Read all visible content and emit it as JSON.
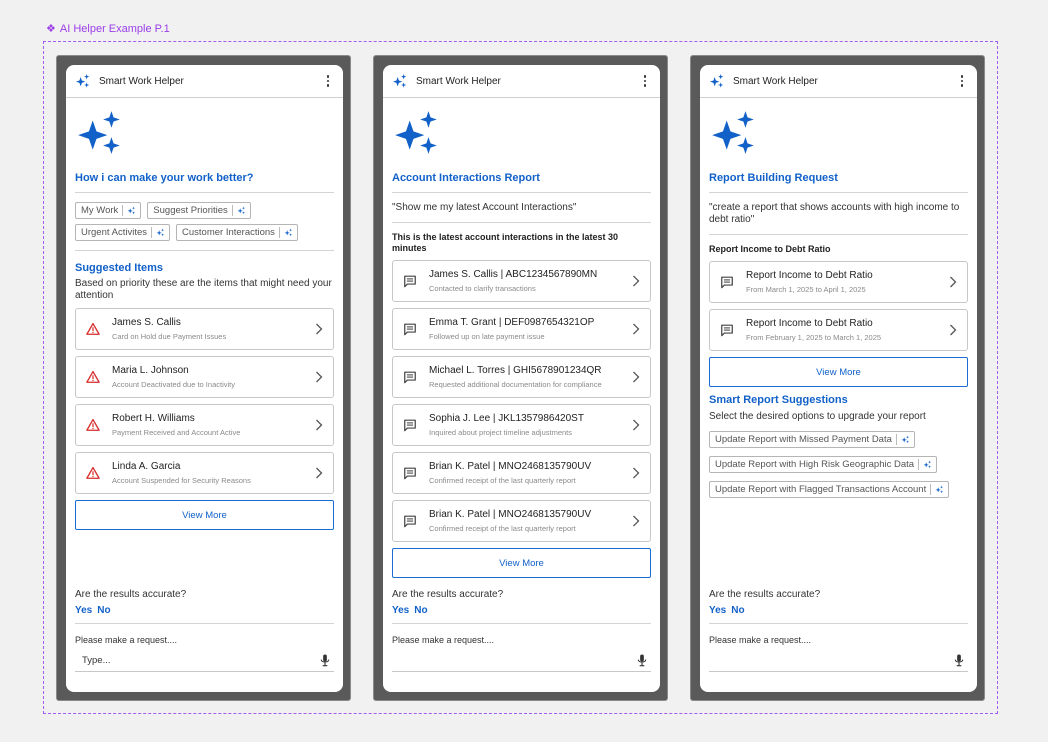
{
  "frame_label": "AI Helper Example P.1",
  "colors": {
    "accent": "#1261c9",
    "frame": "#a35cf0",
    "alert": "#d62b2b",
    "phone_bezel": "#5a5a5a"
  },
  "app_title": "Smart Work Helper",
  "footer": {
    "question": "Are the results accurate?",
    "yes": "Yes",
    "no": "No",
    "request_label": "Please make a request....",
    "input_value": "Type...",
    "input_value_empty": ""
  },
  "view_more": "View More",
  "screen1": {
    "title": "How i can make your work better?",
    "chips": [
      "My Work",
      "Suggest Priorities",
      "Urgent Activites",
      "Customer Interactions"
    ],
    "suggested_title": "Suggested Items",
    "suggested_desc": "Based on priority these are the items that might need your attention",
    "items": [
      {
        "name": "James S. Callis",
        "detail": "Card on Hold due Payment Issues",
        "icon": "warning-icon"
      },
      {
        "name": "Maria L. Johnson",
        "detail": "Account Deactivated due to Inactivity",
        "icon": "warning-icon"
      },
      {
        "name": "Robert H. Williams",
        "detail": "Payment Received and Account Active",
        "icon": "warning-icon"
      },
      {
        "name": "Linda A. Garcia",
        "detail": "Account Suspended for Security Reasons",
        "icon": "warning-icon"
      }
    ]
  },
  "screen2": {
    "title": "Account Interactions Report",
    "query": "\"Show me my latest Account Interactions\"",
    "result_header": "This is the latest account interactions in the latest 30 minutes",
    "items": [
      {
        "name": "James S. Callis | ABC1234567890MN",
        "detail": "Contacted to clarify transactions",
        "icon": "message-icon"
      },
      {
        "name": "Emma T. Grant | DEF0987654321OP",
        "detail": "Followed up on late payment issue",
        "icon": "message-icon"
      },
      {
        "name": "Michael L. Torres | GHI5678901234QR",
        "detail": "Requested additional documentation for compliance",
        "icon": "message-icon"
      },
      {
        "name": "Sophia J. Lee | JKL1357986420ST",
        "detail": "Inquired about project timeline adjustments",
        "icon": "message-icon"
      },
      {
        "name": "Brian K. Patel | MNO2468135790UV",
        "detail": "Confirmed receipt of the last quarterly report",
        "icon": "message-icon"
      },
      {
        "name": "Brian K. Patel | MNO2468135790UV",
        "detail": "Confirmed receipt of the last quarterly report",
        "icon": "message-icon"
      }
    ]
  },
  "screen3": {
    "title": "Report Building Request",
    "query": "\"create a report that shows accounts with high income to debt ratio\"",
    "result_header": "Report Income to Debt Ratio",
    "items": [
      {
        "name": "Report Income to Debt Ratio",
        "detail": "From March 1, 2025 to April 1, 2025",
        "icon": "message-icon"
      },
      {
        "name": "Report Income to Debt Ratio",
        "detail": "From February 1, 2025 to March 1, 2025",
        "icon": "message-icon"
      }
    ],
    "suggestions_title": "Smart Report Suggestions",
    "suggestions_desc": "Select the desired options to upgrade your report",
    "chips": [
      "Update Report with Missed Payment Data",
      "Update Report with High Risk Geographic Data",
      "Update Report with Flagged Transactions Account"
    ]
  }
}
